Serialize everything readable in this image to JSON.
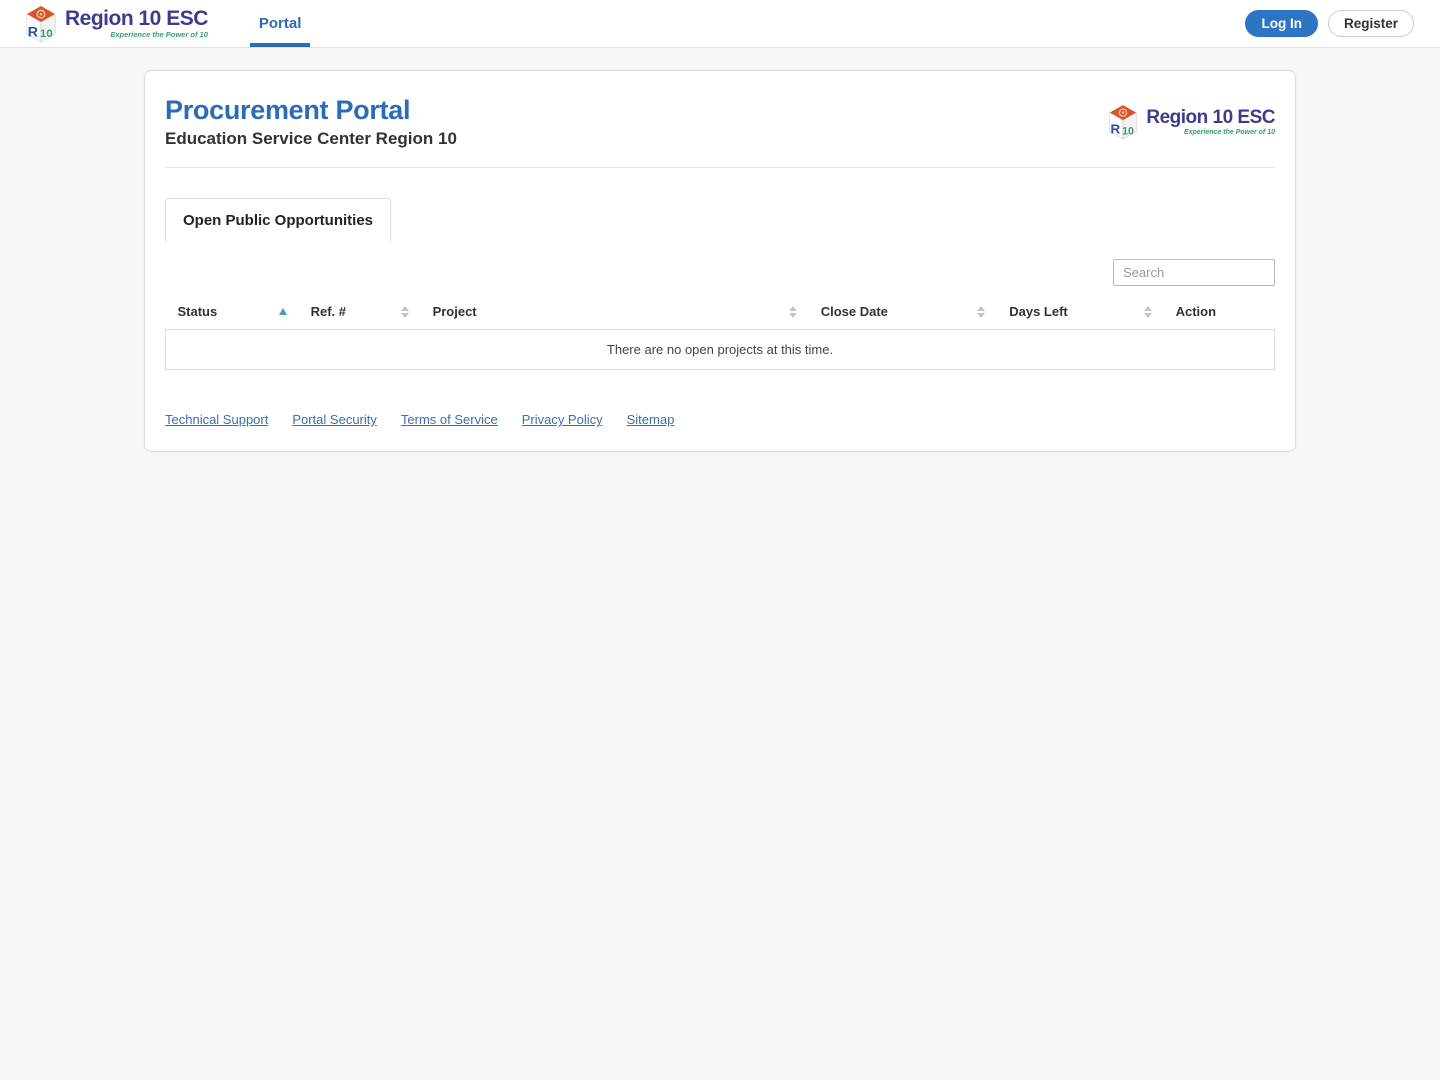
{
  "logo": {
    "brand": "Region 10 ESC",
    "tagline": "Experience the Power of 10"
  },
  "header": {
    "nav_portal_label": "Portal",
    "login_label": "Log In",
    "register_label": "Register"
  },
  "card": {
    "title": "Procurement Portal",
    "subtitle": "Education Service Center Region 10",
    "tab_label": "Open Public Opportunities",
    "search_placeholder": "Search",
    "table": {
      "columns": [
        {
          "label": "Status",
          "sort": "asc"
        },
        {
          "label": "Ref. #",
          "sort": "none"
        },
        {
          "label": "Project",
          "sort": "none"
        },
        {
          "label": "Close Date",
          "sort": "none"
        },
        {
          "label": "Days Left",
          "sort": "none"
        },
        {
          "label": "Action",
          "sort": null
        }
      ],
      "empty_message": "There are no open projects at this time."
    },
    "footer_links": [
      "Technical Support",
      "Portal Security",
      "Terms of Service",
      "Privacy Policy",
      "Sitemap"
    ]
  },
  "colors": {
    "accent_blue": "#2b6cb5",
    "button_blue": "#2e74c4",
    "link_blue": "#3a6fb0",
    "sort_active_blue": "#4b96c8",
    "logo_indigo": "#3d3b8e",
    "logo_green": "#3a9c6d",
    "logo_orange": "#d9532b",
    "page_background": "#f8f8f8"
  }
}
